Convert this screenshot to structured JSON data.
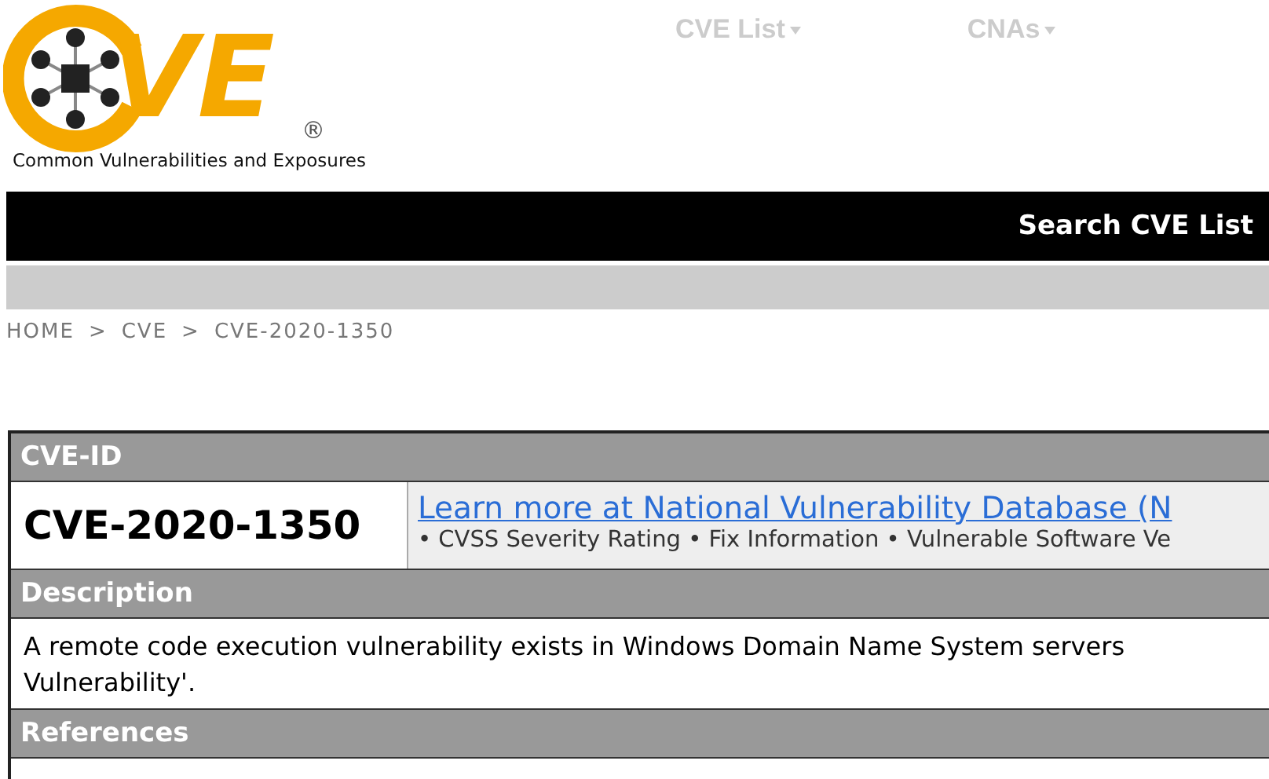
{
  "logo": {
    "letters": "VE",
    "registered": "®",
    "tagline": "Common Vulnerabilities and Exposures"
  },
  "nav": [
    {
      "label": "CVE List"
    },
    {
      "label": "CNAs"
    }
  ],
  "search_bar": {
    "title": "Search CVE List"
  },
  "breadcrumb": [
    "HOME",
    "CVE",
    "CVE-2020-1350"
  ],
  "breadcrumb_separator": ">",
  "record": {
    "id_header": "CVE-ID",
    "id": "CVE-2020-1350",
    "nvd_link": "Learn more at National Vulnerability Database (N",
    "nvd_features": "• CVSS Severity Rating • Fix Information • Vulnerable Software Ve",
    "description_header": "Description",
    "description_lines": [
      "A remote code execution vulnerability exists in Windows Domain Name System servers",
      "Vulnerability'."
    ],
    "references_header": "References"
  }
}
